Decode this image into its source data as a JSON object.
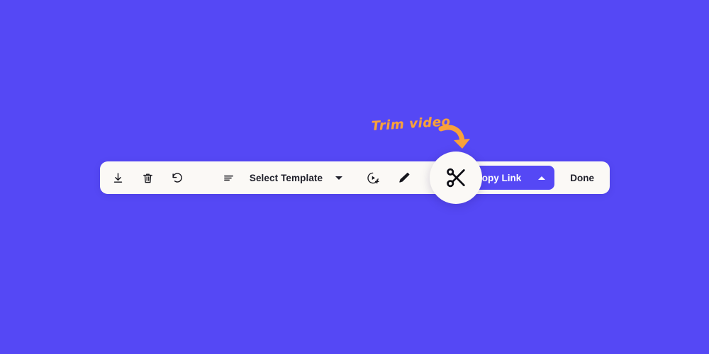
{
  "background_color": "#5548f5",
  "annotation": {
    "text": "Trim video",
    "color": "#f9a13a",
    "arrow_icon": "curved-arrow-down-right-icon"
  },
  "toolbar": {
    "background_color": "#fbf9f6",
    "left_tools": [
      {
        "name": "download-button",
        "icon": "download-icon"
      },
      {
        "name": "delete-button",
        "icon": "trash-icon"
      },
      {
        "name": "restore-button",
        "icon": "undo-icon"
      }
    ],
    "menu": {
      "name": "list-menu-button",
      "icon": "hamburger-list-icon"
    },
    "template_select": {
      "label": "Select Template",
      "caret_icon": "chevron-down-icon"
    },
    "mid_tools": [
      {
        "name": "add-clip-button",
        "icon": "play-circle-plus-icon"
      },
      {
        "name": "draw-button",
        "icon": "pen-icon"
      }
    ],
    "copy_link": {
      "label": "Copy Link",
      "icon": "link-icon",
      "caret_icon": "chevron-up-icon",
      "background_color": "#5548f5",
      "text_color": "#ffffff"
    },
    "done": {
      "label": "Done"
    }
  },
  "spotlight": {
    "name": "trim-tool-button",
    "icon": "scissors-icon",
    "background_color": "#fbf9f6"
  }
}
